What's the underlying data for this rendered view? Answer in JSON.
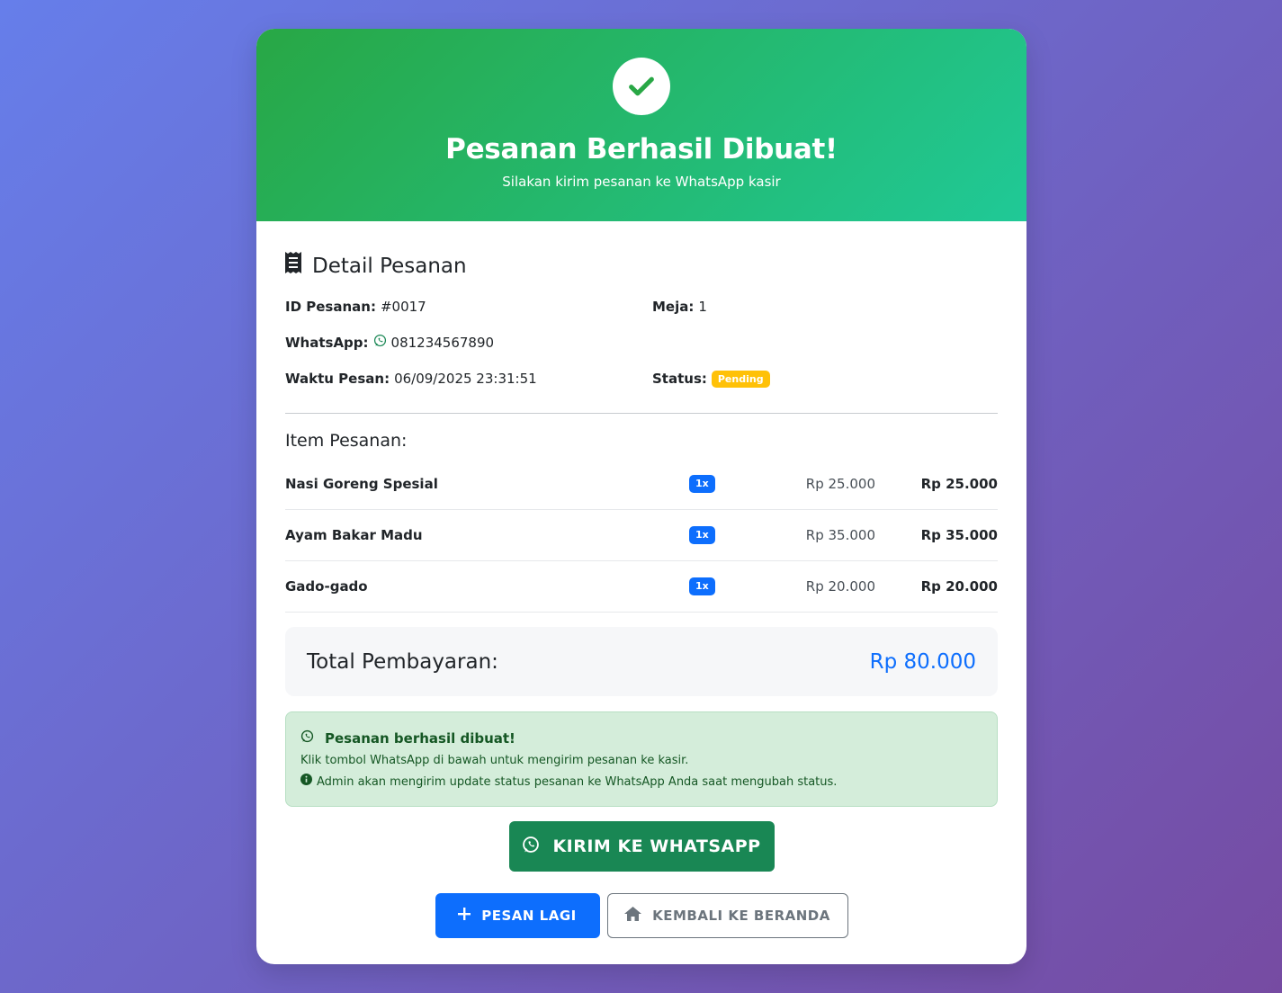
{
  "hero": {
    "title": "Pesanan Berhasil Dibuat!",
    "subtitle": "Silakan kirim pesanan ke WhatsApp kasir",
    "icon": "check-icon",
    "gradient_start": "#28a745",
    "gradient_end": "#20c997"
  },
  "detail": {
    "title": "Detail Pesanan",
    "icon": "receipt-icon",
    "order_id_label": "ID Pesanan:",
    "order_id": "#0017",
    "table_label": "Meja:",
    "table": "1",
    "whatsapp_label": "WhatsApp:",
    "whatsapp": "081234567890",
    "time_label": "Waktu Pesan:",
    "time": "06/09/2025 23:31:51",
    "status_label": "Status:",
    "status": "Pending",
    "status_color": "#ffc107"
  },
  "items": {
    "title": "Item Pesanan:",
    "rows": [
      {
        "name": "Nasi Goreng Spesial",
        "qty": "1x",
        "price": "Rp 25.000",
        "subtotal": "Rp 25.000"
      },
      {
        "name": "Ayam Bakar Madu",
        "qty": "1x",
        "price": "Rp 35.000",
        "subtotal": "Rp 35.000"
      },
      {
        "name": "Gado-gado",
        "qty": "1x",
        "price": "Rp 20.000",
        "subtotal": "Rp 20.000"
      }
    ]
  },
  "total": {
    "label": "Total Pembayaran:",
    "value": "Rp 80.000",
    "color": "#0d6efd"
  },
  "alert": {
    "title": "Pesanan berhasil dibuat!",
    "line1": "Klik tombol WhatsApp di bawah untuk mengirim pesanan ke kasir.",
    "line2": "Admin akan mengirim update status pesanan ke WhatsApp Anda saat mengubah status."
  },
  "buttons": {
    "whatsapp": "KIRIM KE WHATSAPP",
    "order_again": "PESAN LAGI",
    "home": "KEMBALI KE BERANDA",
    "whatsapp_color": "#198754",
    "primary_color": "#0d6efd"
  }
}
